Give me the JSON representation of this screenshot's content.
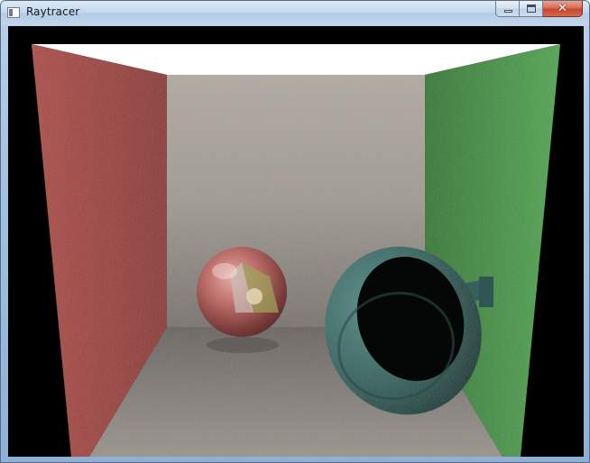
{
  "window": {
    "title": "Raytracer",
    "icon": "window-app-icon",
    "controls": {
      "minimize_icon": "minimize-icon",
      "maximize_icon": "maximize-icon",
      "close_icon": "close-icon",
      "close_glyph": "✕"
    }
  },
  "scene": {
    "type": "cornell-box-render",
    "colors": {
      "left_wall": "#b35a55",
      "right_wall": "#4f9a4f",
      "back_wall": "#9e9891",
      "floor": "#8a857f",
      "ceiling_light": "#ffffff",
      "mirror_sphere": "#b86a66",
      "teal_object": "#3d6b66"
    }
  }
}
